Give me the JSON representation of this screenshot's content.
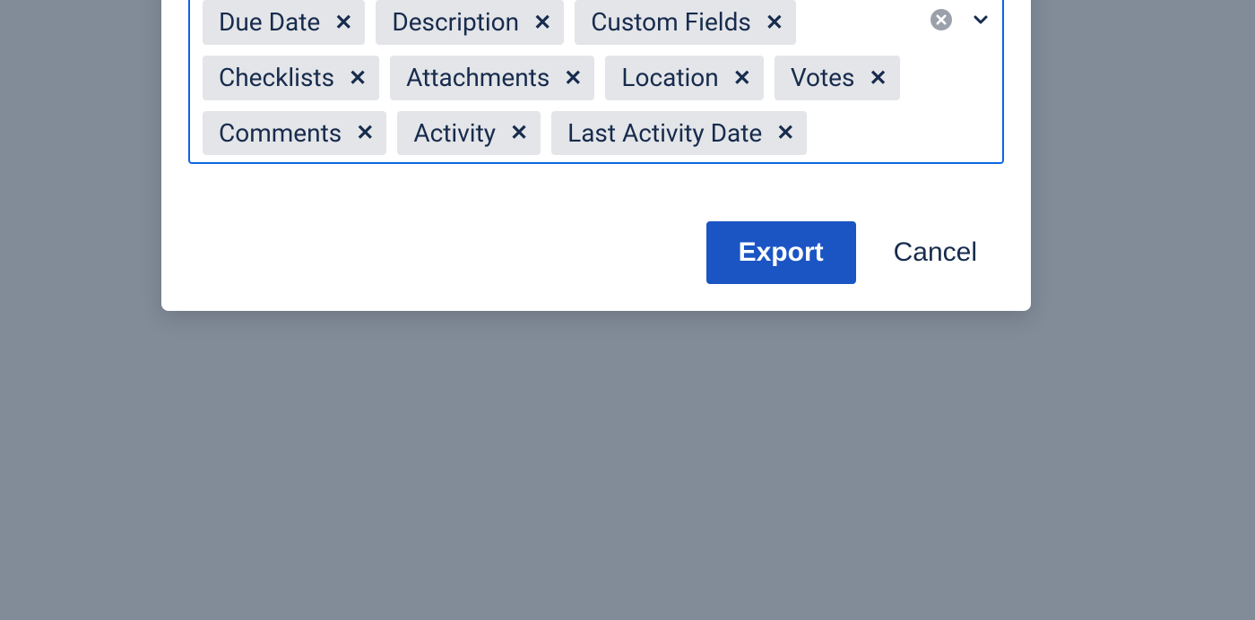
{
  "chips": [
    "Due Date",
    "Description",
    "Custom Fields",
    "Checklists",
    "Attachments",
    "Location",
    "Votes",
    "Comments",
    "Activity",
    "Last Activity Date"
  ],
  "actions": {
    "export_label": "Export",
    "cancel_label": "Cancel"
  }
}
